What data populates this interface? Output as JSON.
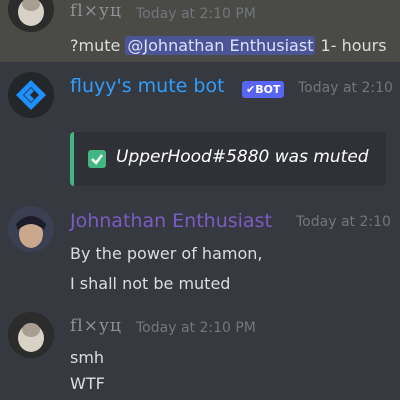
{
  "messages": [
    {
      "author": "fl×уц",
      "timestamp": "Today at 2:10 PM",
      "text_before": "?mute ",
      "mention": "@Johnathan Enthusiast",
      "text_after": " 1- hours"
    },
    {
      "author": "fluyy's mute bot",
      "bot_tag": "✔BOT",
      "timestamp": "Today at 2:10",
      "embed_text": "UpperHood#5880 was muted"
    },
    {
      "author": "Johnathan Enthusiast",
      "timestamp": "Today at 2:10",
      "lines": [
        "By the power of hamon,",
        "I shall not be muted"
      ]
    },
    {
      "author": "fl×уц",
      "timestamp": "Today at 2:10 PM",
      "lines": [
        "smh",
        "WTF"
      ]
    }
  ],
  "colors": {
    "background": "#36393f",
    "highlight": "#4a4b46",
    "bot_name": "#2f9fff",
    "johnathan_name": "#7b5cc4",
    "embed_border": "#43b581",
    "bot_tag": "#5865f2"
  },
  "icons": {
    "bot_avatar": "blue-chevron-logo",
    "embed_check": "check-box"
  }
}
